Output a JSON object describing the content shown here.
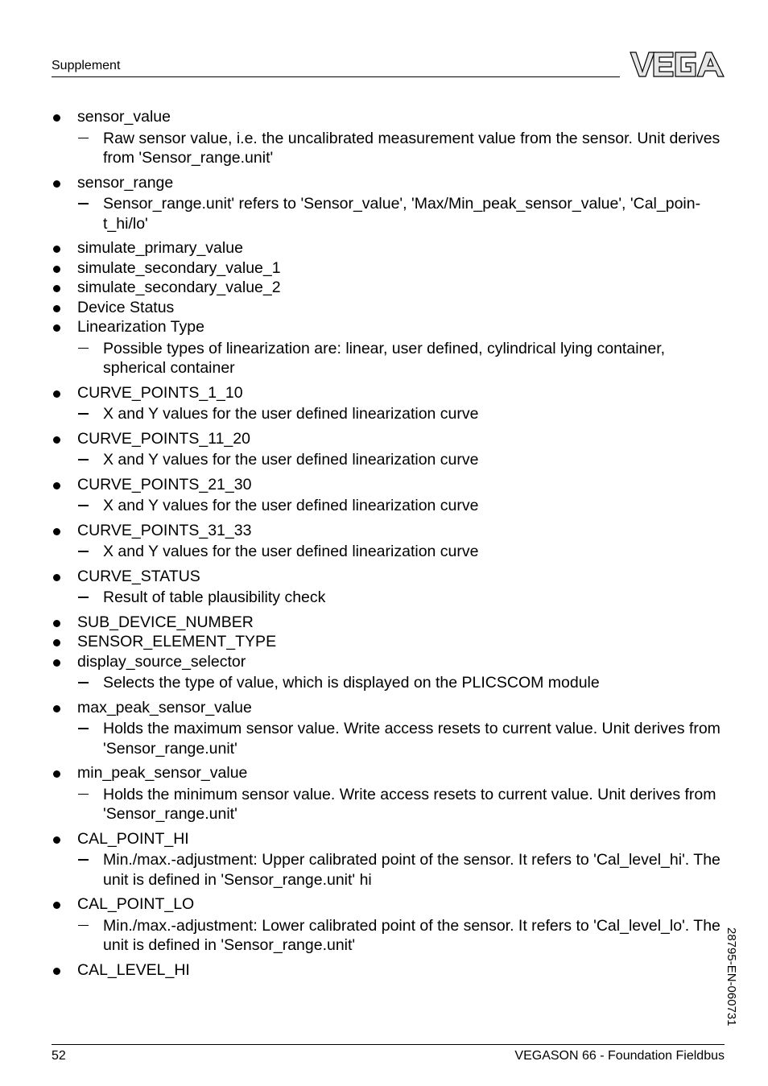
{
  "header": {
    "section": "Supplement",
    "logo_text": "VEGA"
  },
  "items": [
    {
      "term": "sensor_value",
      "desc": "Raw sensor value, i.e. the uncalibrated measurement value from the sensor. Unit derives from 'Sensor_range.unit'"
    },
    {
      "term": "sensor_range",
      "desc": "Sensor_range.unit' refers to 'Sensor_value', 'Max/Min_peak_sensor_value', 'Cal_poin­t_hi/lo'"
    },
    {
      "term": "simulate_primary_value"
    },
    {
      "term": "simulate_secondary_value_1"
    },
    {
      "term": "simulate_secondary_value_2"
    },
    {
      "term": "Device Status"
    },
    {
      "term": "Linearization Type",
      "desc": "Possible types of linearization are: linear, user defined, cylindrical lying container, spherical container"
    },
    {
      "term": "CURVE_POINTS_1_10",
      "desc": "X and Y values for the user defined linearization curve"
    },
    {
      "term": "CURVE_POINTS_11_20",
      "desc": "X and Y values for the user defined linearization curve"
    },
    {
      "term": "CURVE_POINTS_21_30",
      "desc": "X and Y values for the user defined linearization curve"
    },
    {
      "term": "CURVE_POINTS_31_33",
      "desc": "X and Y values for the user defined linearization curve"
    },
    {
      "term": "CURVE_STATUS",
      "desc": "Result of table plausibility check"
    },
    {
      "term": "SUB_DEVICE_NUMBER"
    },
    {
      "term": "SENSOR_ELEMENT_TYPE"
    },
    {
      "term": "display_source_selector",
      "desc": "Selects the type of value, which is displayed on the PLICSCOM module"
    },
    {
      "term": "max_peak_sensor_value",
      "desc": "Holds the maximum sensor value. Write access resets to current value. Unit derives from 'Sensor_range.unit'"
    },
    {
      "term": "min_peak_sensor_value",
      "desc": "Holds the minimum sensor value. Write access resets to current value. Unit derives from 'Sensor_range.unit'"
    },
    {
      "term": "CAL_POINT_HI",
      "desc": "Min./max.-adjustment: Upper calibrated point of the sensor. It refers to 'Cal_level_hi'. The unit is defined in 'Sensor_range.unit' hi"
    },
    {
      "term": "CAL_POINT_LO",
      "desc": "Min./max.-adjustment: Lower calibrated point of the sensor. It refers to 'Cal_level_lo'. The unit is defined in 'Sensor_range.unit'"
    },
    {
      "term": "CAL_LEVEL_HI"
    }
  ],
  "footer": {
    "page_number": "52",
    "title": "VEGASON 66 - Foundation Fieldbus",
    "doc_code": "28795-EN-060731"
  }
}
